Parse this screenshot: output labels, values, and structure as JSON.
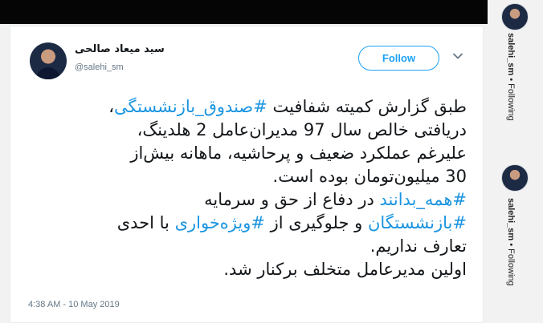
{
  "tweet": {
    "author_name": "سید میعاد صالحی",
    "handle": "@salehi_sm",
    "follow_label": "Follow",
    "lines": [
      [
        {
          "t": "طبق گزارش کمیته شفافیت "
        },
        {
          "t": "#صندوق_بازنشستگی",
          "ht": true
        },
        {
          "t": "،"
        }
      ],
      [
        {
          "t": "دریافتی خالص سال 97 مدیران‌عامل 2 هلدینگ،"
        }
      ],
      [
        {
          "t": "علیرغم عملکرد ضعیف و پرحاشیه، ماهانه بیش‌از"
        }
      ],
      [
        {
          "t": "30 میلیون‌تومان بوده است."
        }
      ],
      [
        {
          "t": "#همه_بدانند",
          "ht": true
        },
        {
          "t": " در دفاع از حق و سرمایه"
        }
      ],
      [
        {
          "t": "#بازنشستگان",
          "ht": true
        },
        {
          "t": " و جلوگیری از "
        },
        {
          "t": "#ویژه‌خواری",
          "ht": true
        },
        {
          "t": " با احدی"
        }
      ],
      [
        {
          "t": "تعارف نداریم."
        }
      ],
      [
        {
          "t": "اولین مدیرعامل متخلف برکنار شد."
        }
      ]
    ],
    "timestamp": "4:38 AM - 10 May 2019"
  },
  "side_panel": {
    "items": [
      {
        "username": "salehi_sm",
        "separator": " • ",
        "status": "Following"
      },
      {
        "username": "salehi_sm",
        "separator": " • ",
        "status": "Following"
      }
    ]
  },
  "colors": {
    "accent": "#1da1f2",
    "hashtag": "#1b95e0",
    "text": "#14171a",
    "muted": "#657786"
  }
}
